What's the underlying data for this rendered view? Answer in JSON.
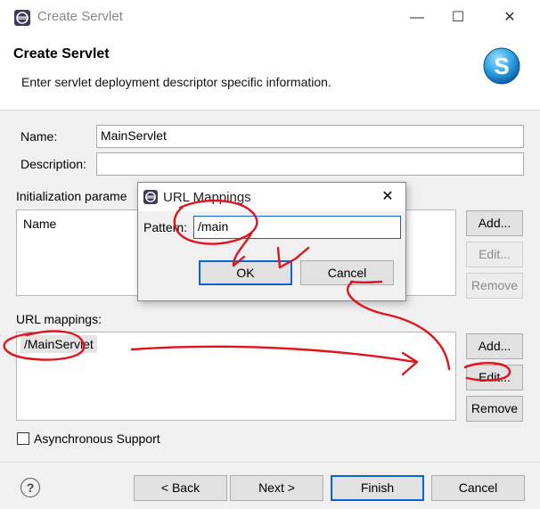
{
  "window": {
    "title": "Create Servlet",
    "minimize_icon": "minimize-icon",
    "maximize_icon": "maximize-icon",
    "close_icon": "close-icon"
  },
  "banner": {
    "heading": "Create Servlet",
    "description": "Enter servlet deployment descriptor specific information.",
    "logo_letter": "S"
  },
  "form": {
    "name_label": "Name:",
    "name_value": "MainServlet",
    "description_label": "Description:",
    "description_value": ""
  },
  "init_params": {
    "label": "Initialization parame",
    "column_header": "Name",
    "add_label": "Add...",
    "edit_label": "Edit...",
    "remove_label": "Remove"
  },
  "url_mappings": {
    "label": "URL mappings:",
    "items": [
      "/MainServlet"
    ],
    "add_label": "Add...",
    "edit_label": "Edit...",
    "remove_label": "Remove"
  },
  "async": {
    "label": "Asynchronous Support",
    "checked": false
  },
  "footer": {
    "help_glyph": "?",
    "back_label": "< Back",
    "next_label": "Next >",
    "finish_label": "Finish",
    "cancel_label": "Cancel"
  },
  "dialog": {
    "title": "URL Mappings",
    "pattern_label": "Pattern:",
    "pattern_value": "/main",
    "ok_label": "OK",
    "cancel_label": "Cancel"
  },
  "colors": {
    "annotation": "#e0141e",
    "focus_border": "#0a64d2",
    "selection_bg": "#e4e4e4"
  }
}
